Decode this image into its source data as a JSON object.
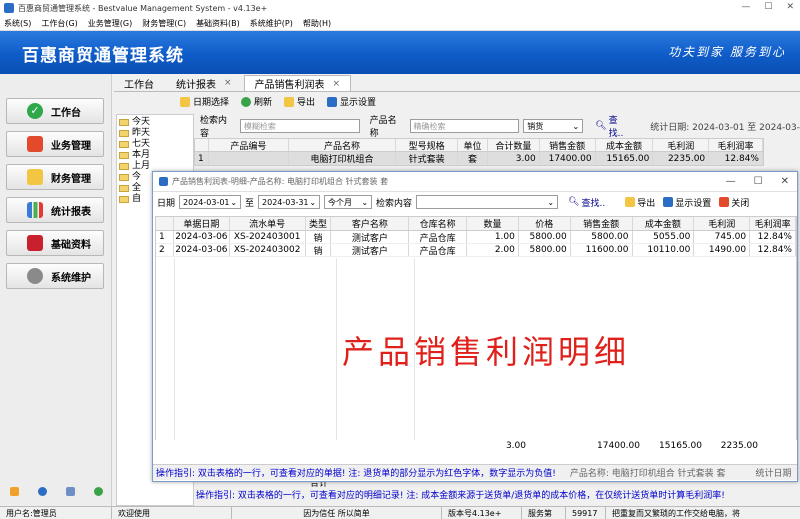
{
  "window": {
    "title": "百惠商贸通管理系统 - Bestvalue Management System - v4.13e+"
  },
  "menu": [
    "系统(S)",
    "工作台(G)",
    "业务管理(G)",
    "财务管理(C)",
    "基础资料(B)",
    "系统维护(P)",
    "帮助(H)"
  ],
  "banner": {
    "title": "百惠商贸通管理系统",
    "slogan": "功夫到家  服务到心"
  },
  "sidebar": {
    "items": [
      {
        "label": "工作台",
        "icon": "check-icon"
      },
      {
        "label": "业务管理",
        "icon": "home-icon"
      },
      {
        "label": "财务管理",
        "icon": "folder-icon"
      },
      {
        "label": "统计报表",
        "icon": "chart-icon"
      },
      {
        "label": "基础资料",
        "icon": "book-icon"
      },
      {
        "label": "系统维护",
        "icon": "gear-icon"
      }
    ]
  },
  "tabs": [
    "工作台",
    "统计报表",
    "产品销售利润表"
  ],
  "toolbar": {
    "date_select": "日期选择",
    "refresh": "刷新",
    "export": "导出",
    "display_settings": "显示设置"
  },
  "tree": [
    "今天",
    "昨天",
    "七天",
    "本月",
    "上月",
    "今",
    "全",
    "自"
  ],
  "search": {
    "label": "检索内容",
    "placeholder": "模糊检索",
    "product_label": "产品名称",
    "product_placeholder": "精确检索",
    "type_value": "销货",
    "find": "查找..",
    "stat_date": "统计日期: 2024-03-01 至 2024-03-"
  },
  "bg_table": {
    "headers": [
      "",
      "产品编号",
      "产品名称",
      "型号规格",
      "单位",
      "合计数量",
      "销售金额",
      "成本金额",
      "毛利润",
      "毛利润率"
    ],
    "rows": [
      [
        "1",
        "",
        "电脑打印机组合",
        "针式套装",
        "套",
        "3.00",
        "17400.00",
        "15165.00",
        "2235.00",
        "12.84%"
      ]
    ],
    "total_label": "合计",
    "hint": "操作指引: 双击表格的一行，可查看对应的明细记录! 注: 成本金额来源于送货单/退货单的成本价格，在仅统计送货单时计算毛利润率!"
  },
  "dialog": {
    "title": "产品销售利润表-明细-产品名称: 电脑打印机组合  针式套装  套",
    "date_label": "日期",
    "date_from": "2024-03-01",
    "to_label": "至",
    "date_to": "2024-03-31",
    "month": "今个月",
    "search_label": "检索内容",
    "find": "查找..",
    "export": "导出",
    "display_settings": "显示设置",
    "close": "关闭",
    "headers": [
      "",
      "单据日期",
      "流水单号",
      "类型",
      "客户名称",
      "仓库名称",
      "数量",
      "价格",
      "销售金额",
      "成本金额",
      "毛利润",
      "毛利润率"
    ],
    "rows": [
      [
        "1",
        "2024-03-06",
        "XS-202403001",
        "销",
        "测试客户",
        "产品仓库",
        "1.00",
        "5800.00",
        "5800.00",
        "5055.00",
        "745.00",
        "12.84%"
      ],
      [
        "2",
        "2024-03-06",
        "XS-202403002",
        "销",
        "测试客户",
        "产品仓库",
        "2.00",
        "5800.00",
        "11600.00",
        "10110.00",
        "1490.00",
        "12.84%"
      ]
    ],
    "totals": {
      "qty": "3.00",
      "sales": "17400.00",
      "cost": "15165.00",
      "profit": "2235.00"
    },
    "watermark": "产品销售利润明细",
    "hint": "操作指引: 双击表格的一行，可查看对应的单据! 注: 退货单的部分显示为红色字体，数字显示为负值!",
    "hint_right": "产品名称: 电脑打印机组合 针式套装 套",
    "hint_right2": "统计日期"
  },
  "status": {
    "user": "用户名:管理员",
    "welcome": "欢迎使用",
    "motto": "因为信任 所以简单",
    "version": "版本号4.13e+",
    "service_label": "服务第",
    "service_no": "59917",
    "slogan": "把重复而又繁琐的工作交给电脑，将"
  }
}
